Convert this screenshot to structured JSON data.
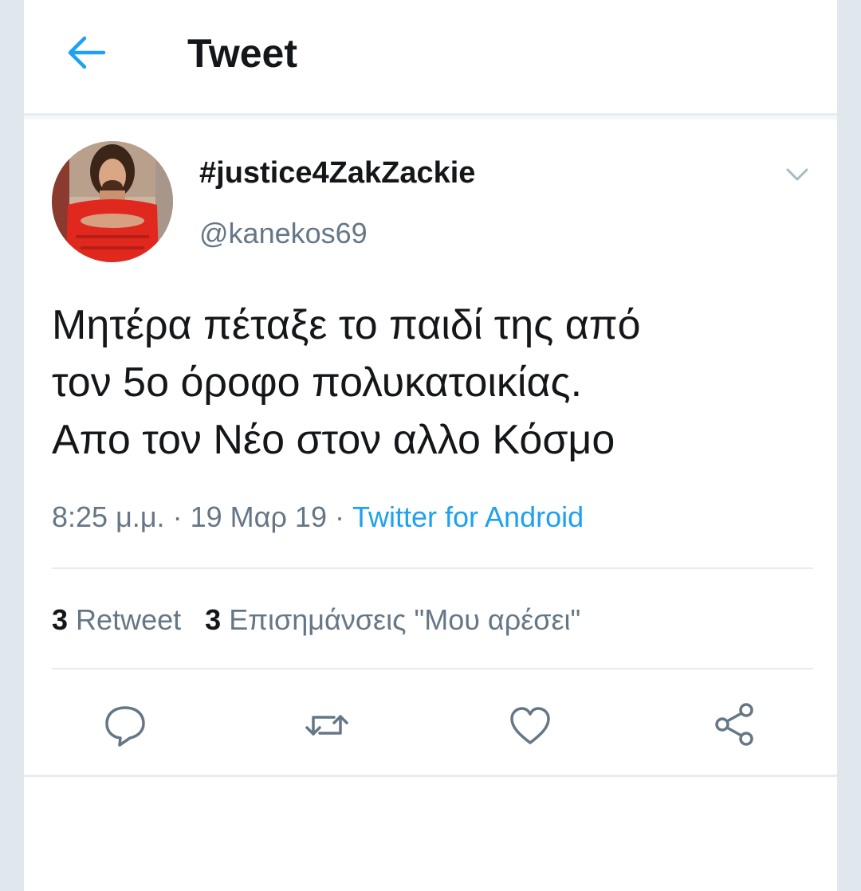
{
  "header": {
    "back_icon": "arrow-left-icon",
    "title": "Tweet"
  },
  "tweet": {
    "author": {
      "display_name": "#justice4ZakZackie",
      "handle": "@kanekos69"
    },
    "text_lines": [
      "Μητέρα πέταξε το παιδί της από",
      "τον 5ο όροφο πολυκατοικίας.",
      "Απο τον Νέο στον αλλο Κόσμο"
    ],
    "time": "8:25 μ.μ.",
    "date": "19 Μαρ 19",
    "separator": "·",
    "source": "Twitter for Android",
    "stats": {
      "retweets_count": "3",
      "retweets_label": "Retweet",
      "likes_count": "3",
      "likes_label": "Επισημάνσεις \"Μου αρέσει\""
    },
    "actions": [
      "reply-icon",
      "retweet-icon",
      "like-icon",
      "share-icon"
    ]
  },
  "colors": {
    "accent": "#1da1f2",
    "text_primary": "#14171a",
    "text_secondary": "#657786",
    "divider": "#e6ecf0",
    "page_background": "#e1e8ed"
  }
}
